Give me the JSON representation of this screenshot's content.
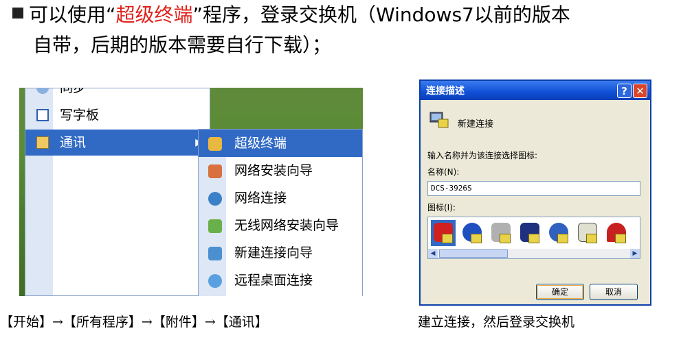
{
  "heading": {
    "part1": "可以使用“",
    "highlight": "超级终端",
    "part2": "”程序，登录交换机（Windows7以前的版本",
    "line2": "自带，后期的版本需要自行下载）；"
  },
  "start_menu": {
    "items": [
      {
        "label": "同步",
        "icon": "sync-icon"
      },
      {
        "label": "写字板",
        "icon": "wordpad-icon"
      },
      {
        "label": "通讯",
        "icon": "communications-folder-icon",
        "arrow": "▶"
      }
    ],
    "submenu": [
      {
        "label": "超级终端",
        "icon": "hyperterminal-icon"
      },
      {
        "label": "网络安装向导",
        "icon": "network-setup-icon"
      },
      {
        "label": "网络连接",
        "icon": "network-connections-icon"
      },
      {
        "label": "无线网络安装向导",
        "icon": "wireless-setup-icon"
      },
      {
        "label": "新建连接向导",
        "icon": "new-connection-icon"
      },
      {
        "label": "远程桌面连接",
        "icon": "remote-desktop-icon"
      }
    ]
  },
  "dialog": {
    "title": "连接描述",
    "help_btn": "?",
    "close_btn": "✕",
    "connection_label": "新建连接",
    "prompt": "输入名称并为该连接选择图标:",
    "name_label": "名称(N):",
    "name_value": "DCS-3926S",
    "icon_label": "图标(I):",
    "ok": "确定",
    "cancel": "取消",
    "icons": [
      "phone-icon",
      "globe-icon",
      "fax-icon",
      "mci-icon",
      "ge-icon",
      "document-icon",
      "umbrella-icon"
    ]
  },
  "captions": {
    "left": "【开始】→【所有程序】→【附件】→【通讯】",
    "right": "建立连接，然后登录交换机"
  }
}
